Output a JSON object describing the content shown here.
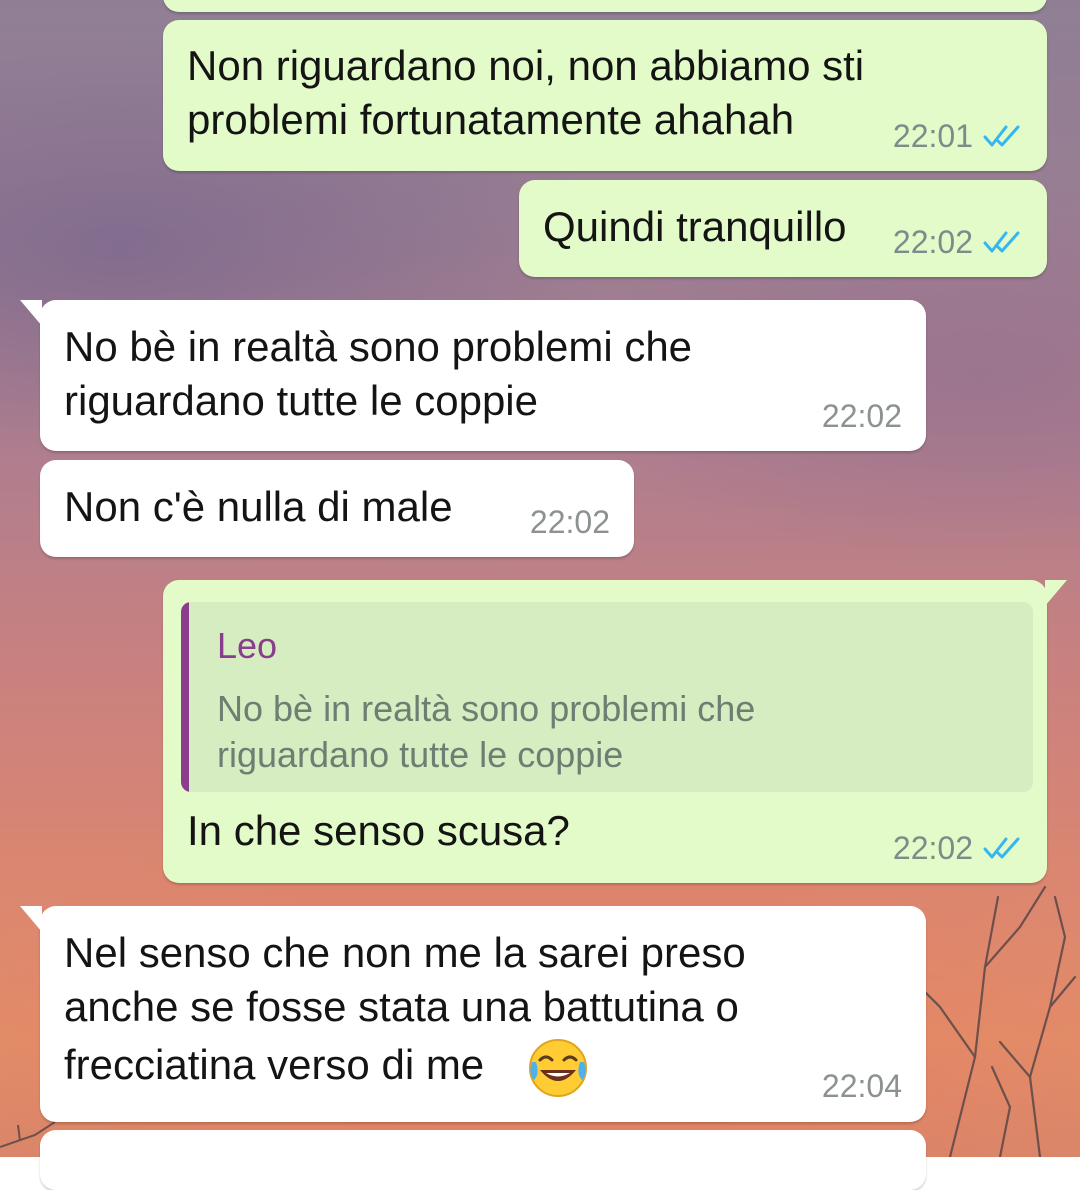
{
  "chat": {
    "messages": [
      {
        "lines": [
          "Non riguardano noi, non abbiamo sti",
          "problemi fortunatamente ahahah"
        ],
        "time": "22:01"
      },
      {
        "lines": [
          "Quindi tranquillo"
        ],
        "time": "22:02"
      },
      {
        "lines": [
          "No bè in realtà sono problemi che",
          "riguardano tutte le coppie"
        ],
        "time": "22:02"
      },
      {
        "lines": [
          "Non c'è nulla di male"
        ],
        "time": "22:02"
      },
      {
        "quote": {
          "author": "Leo",
          "lines": [
            "No bè in realtà sono problemi che",
            "riguardano tutte le coppie"
          ]
        },
        "lines": [
          "In che senso scusa?"
        ],
        "time": "22:02"
      },
      {
        "lines": [
          "Nel senso che non me la sarei preso",
          "anche se fosse stata una battutina o",
          "frecciatina verso di me"
        ],
        "emoji": "face-with-tears-of-joy-icon",
        "time": "22:04"
      }
    ]
  },
  "colors": {
    "outgoing_bubble": "#e2fbc8",
    "incoming_bubble": "#ffffff",
    "read_ticks": "#34b7f1",
    "quote_accent": "#8a3d8c"
  },
  "icons": {
    "read_receipt": "double-check-icon",
    "emoji": "face-with-tears-of-joy-icon"
  }
}
